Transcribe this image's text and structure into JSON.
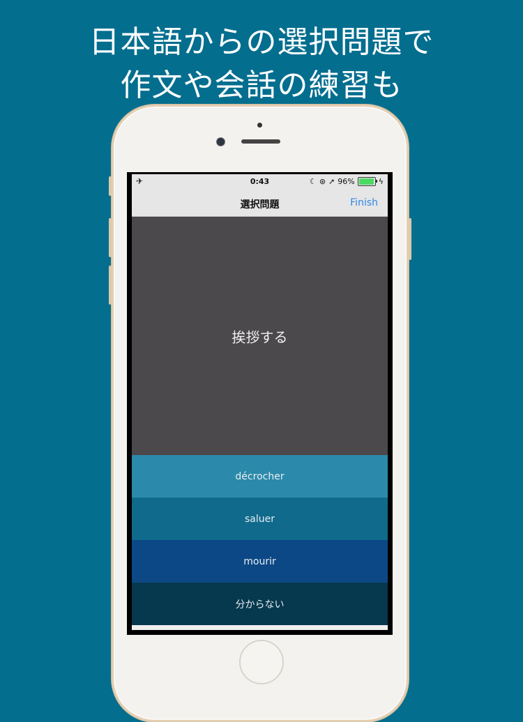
{
  "headline": {
    "line1": "日本語からの選択問題で",
    "line2": "作文や会話の練習も"
  },
  "status_bar": {
    "time": "0:43",
    "battery_text": "96%",
    "battery_level": 0.96,
    "icons": [
      "airplane-icon",
      "moon-icon",
      "lock-rotation-icon",
      "location-arrow-icon",
      "battery-icon",
      "charging-icon"
    ]
  },
  "nav": {
    "title": "選択問題",
    "finish_label": "Finish",
    "finish_color": "#2e87e6"
  },
  "question": {
    "text": "挨拶する"
  },
  "answers": [
    {
      "label": "décrocher",
      "color": "#2b8aab"
    },
    {
      "label": "saluer",
      "color": "#0f6a8c"
    },
    {
      "label": "mourir",
      "color": "#0c4885"
    },
    {
      "label": "分からない",
      "color": "#06384e"
    }
  ],
  "colors": {
    "background": "#046e8f",
    "question_bg": "#4b494b"
  }
}
